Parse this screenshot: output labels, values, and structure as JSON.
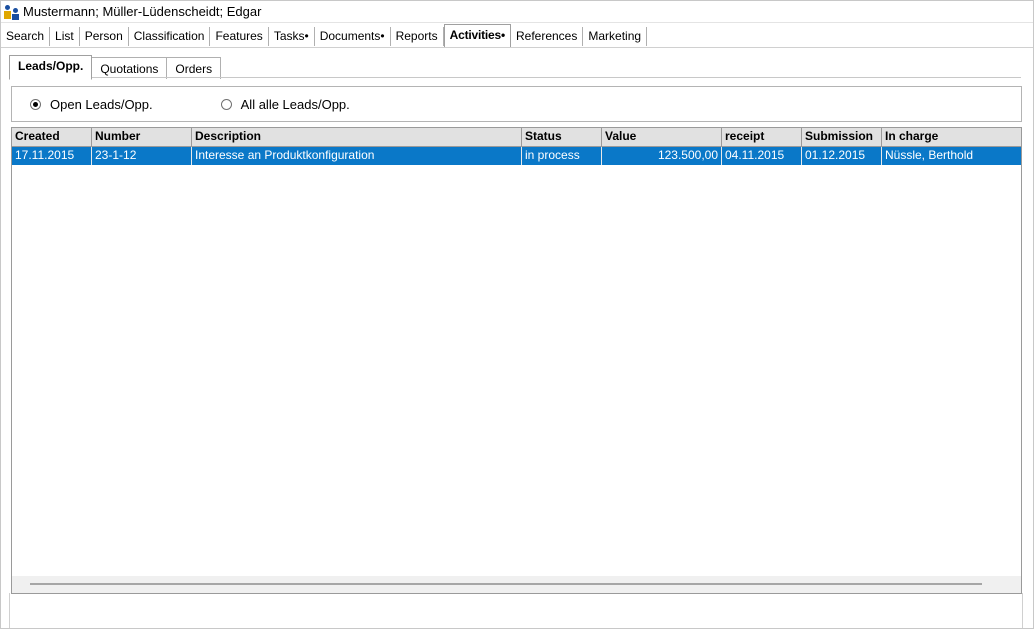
{
  "window": {
    "title": "Mustermann; Müller-Lüdenscheidt; Edgar",
    "icon": "app-people-icon"
  },
  "main_tabs": [
    {
      "label": "Search"
    },
    {
      "label": "List"
    },
    {
      "label": "Person"
    },
    {
      "label": "Classification"
    },
    {
      "label": "Features"
    },
    {
      "label": "Tasks•"
    },
    {
      "label": "Documents•"
    },
    {
      "label": "Reports"
    },
    {
      "label": "Activities•",
      "active": true
    },
    {
      "label": "References"
    },
    {
      "label": "Marketing"
    }
  ],
  "sub_tabs": [
    {
      "label": "Leads/Opp.",
      "active": true
    },
    {
      "label": "Quotations"
    },
    {
      "label": "Orders"
    }
  ],
  "filter": {
    "open_label": "Open Leads/Opp.",
    "all_label": "All alle Leads/Opp.",
    "selected": "open"
  },
  "table": {
    "columns": [
      "Created",
      "Number",
      "Description",
      "Status",
      "Value",
      "receipt",
      "Submission",
      "In charge"
    ],
    "rows": [
      {
        "created": "17.11.2015",
        "number": "23-1-12",
        "description": "Interesse an Produktkonfiguration",
        "status": "in process",
        "value": "123.500,00",
        "receipt": "04.11.2015",
        "submission": "01.12.2015",
        "in_charge": "Nüssle, Berthold"
      }
    ]
  },
  "colors": {
    "selection": "#0a78c8",
    "header_bg": "#e1e1e1"
  }
}
